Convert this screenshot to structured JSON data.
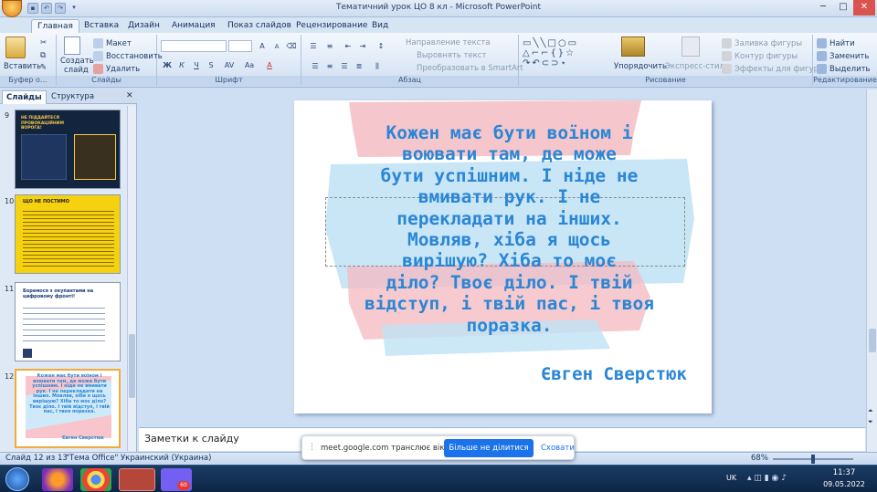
{
  "window": {
    "title": "Тематичний урок ЦО 8 кл  -  Microsoft PowerPoint"
  },
  "tabs": [
    {
      "label": "Главная",
      "active": true
    },
    {
      "label": "Вставка"
    },
    {
      "label": "Дизайн"
    },
    {
      "label": "Анимация"
    },
    {
      "label": "Показ слайдов"
    },
    {
      "label": "Рецензирование"
    },
    {
      "label": "Вид"
    }
  ],
  "ribbon": {
    "clipboard": {
      "paste": "Вставить",
      "label": "Буфер о..."
    },
    "slides": {
      "create": "Создать",
      "create2": "слайд",
      "layout": "Макет",
      "reset": "Восстановить",
      "delete": "Удалить",
      "label": "Слайды"
    },
    "font": {
      "label": "Шрифт",
      "bold": "Ж",
      "italic": "К",
      "underline": "Ч",
      "strike": "S",
      "spacing": "AV",
      "case": "Aa",
      "grow": "A",
      "shrink": "A"
    },
    "paragraph": {
      "direction": "Направление текста",
      "align": "Выровнять текст",
      "smartart": "Преобразовать в SmartArt",
      "label": "Абзац"
    },
    "drawing": {
      "arrange": "Упорядочить",
      "styles": "Экспресс-стили",
      "fill": "Заливка фигуры",
      "outline": "Контур фигуры",
      "effects": "Эффекты для фигур",
      "label": "Рисование"
    },
    "editing": {
      "find": "Найти",
      "replace": "Заменить",
      "select": "Выделить",
      "label": "Редактирование"
    }
  },
  "panel": {
    "tab_slides": "Слайды",
    "tab_outline": "Структура",
    "thumbs": [
      {
        "num": "9",
        "title": "НЕ ПІДДАЙТЕСЯ ПРОВОКАЦІЙНИМ ВОРОГА!"
      },
      {
        "num": "10",
        "title": "ЩО НЕ ПОСТИМО"
      },
      {
        "num": "11",
        "title": "Боремося з окупантами на цифровому фронті!"
      },
      {
        "num": "12",
        "title": "Кожен має бути воїном і воювати там, де може бути успішним. І ніде не вмивати рук. І не перекладати на інших. Мовляв, хіба я щось вирішую? Хіба то моє діло? Твоє діло. І твій відступ, і твій пас, і твоя поразка.",
        "author": "Євген Сверстюк"
      }
    ]
  },
  "slide": {
    "quote_lines": [
      "Кожен має бути воїном і",
      "воювати там, де може",
      "бути успішним. І ніде не",
      "вмивати рук. І не",
      "перекладати на інших.",
      "Мовляв, хіба я щось",
      "вирішую? Хіба то моє",
      "діло? Твоє діло. І твій",
      "відступ, і твій пас, і твоя",
      "поразка."
    ],
    "author": "Євген Сверстюк"
  },
  "notes": {
    "placeholder": "Заметки к слайду"
  },
  "status": {
    "slide": "Слайд 12 из 13",
    "theme": "\"Тема Office\"",
    "lang": "Украинский (Украина)",
    "zoom": "68%"
  },
  "share": {
    "message": "meet.google.com транслює вікно.",
    "stop": "Більше не ділитися",
    "hide": "Сховати"
  },
  "taskbar": {
    "lang": "UK",
    "time": "11:37",
    "date": "09.05.2022",
    "viber_badge": "60"
  },
  "colors": {
    "quote": "#2b86d4",
    "pink_brush": "#f4b8c0",
    "blue_brush": "#bfe2f5",
    "highlight": "#f2a93b"
  }
}
